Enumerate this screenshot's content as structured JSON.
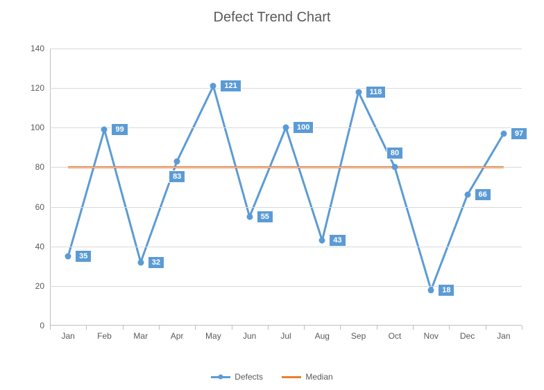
{
  "chart_data": {
    "type": "line",
    "title": "Defect Trend Chart",
    "categories": [
      "Jan",
      "Feb",
      "Mar",
      "Apr",
      "May",
      "Jun",
      "Jul",
      "Aug",
      "Sep",
      "Oct",
      "Nov",
      "Dec",
      "Jan"
    ],
    "series": [
      {
        "name": "Defects",
        "values": [
          35,
          99,
          32,
          83,
          121,
          55,
          100,
          43,
          118,
          80,
          18,
          66,
          97
        ],
        "color": "#5b9bd5"
      },
      {
        "name": "Median",
        "values": [
          80,
          80,
          80,
          80,
          80,
          80,
          80,
          80,
          80,
          80,
          80,
          80,
          80
        ],
        "color": "#ed7d31"
      }
    ],
    "ylim": [
      0,
      140
    ],
    "yticks": [
      0,
      20,
      40,
      60,
      80,
      100,
      120,
      140
    ],
    "xlabel": "",
    "ylabel": "",
    "grid": {
      "y": true
    },
    "legend_position": "bottom",
    "data_label_positions": [
      "right",
      "right",
      "right",
      "below",
      "right",
      "right",
      "right",
      "right",
      "right",
      "above",
      "right",
      "right",
      "right"
    ]
  },
  "legend": {
    "defects_label": "Defects",
    "median_label": "Median"
  }
}
